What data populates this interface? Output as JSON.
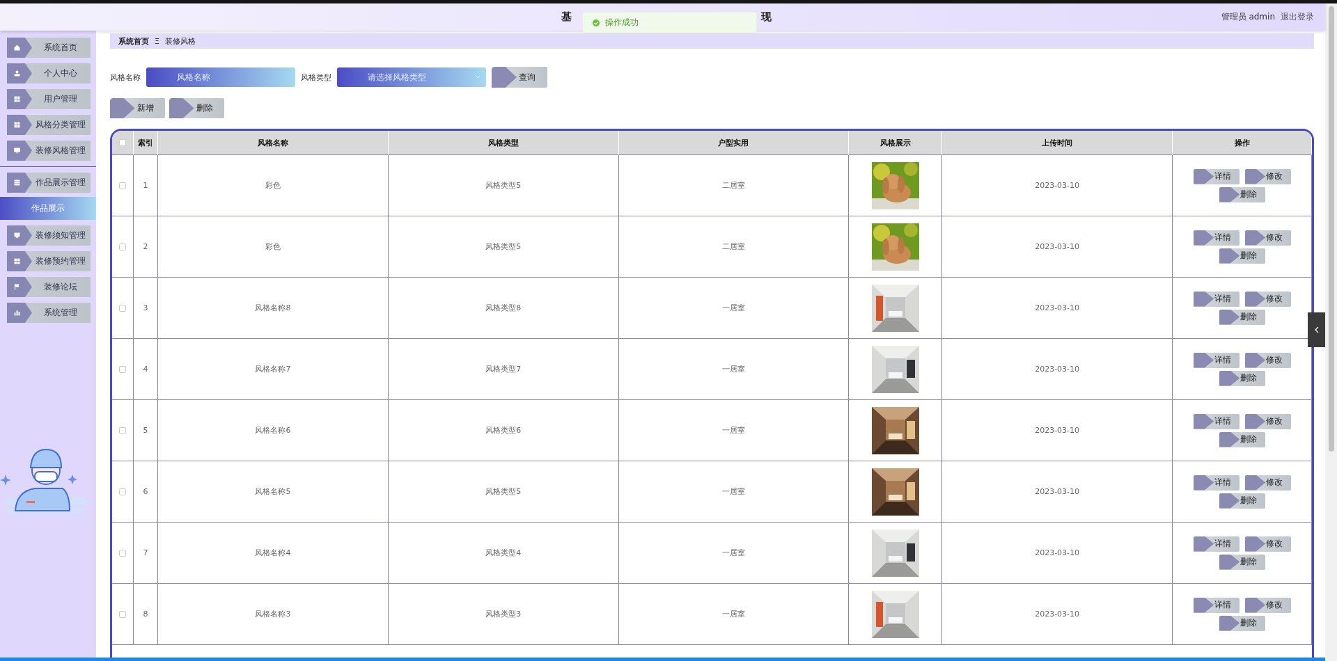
{
  "header": {
    "title_start": "基",
    "title_end": "现",
    "user": "管理员 admin",
    "logout": "退出登录"
  },
  "toast": {
    "message": "操作成功"
  },
  "sidebar": {
    "items": [
      {
        "label": "系统首页"
      },
      {
        "label": "个人中心"
      },
      {
        "label": "用户管理"
      },
      {
        "label": "风格分类管理"
      },
      {
        "label": "装修风格管理"
      },
      {
        "label": "作品展示管理",
        "children": [
          {
            "label": "作品展示",
            "selected": true
          }
        ]
      },
      {
        "label": "装修须知管理"
      },
      {
        "label": "装修预约管理"
      },
      {
        "label": "装修论坛"
      },
      {
        "label": "系统管理"
      }
    ]
  },
  "breadcrumb": {
    "items": [
      "系统首页",
      "装修风格"
    ],
    "separator": "Ξ"
  },
  "search": {
    "fields": [
      {
        "kind": "text",
        "label": "风格名称",
        "placeholder": "风格名称"
      },
      {
        "kind": "select",
        "label": "风格类型",
        "placeholder": "请选择风格类型"
      }
    ],
    "button": "查询"
  },
  "actions": [
    "新增",
    "删除"
  ],
  "table": {
    "select_all_checked": false,
    "columns": [
      "索引",
      "风格名称",
      "风格类型",
      "户型实用",
      "风格展示",
      "上传时间",
      "操作"
    ],
    "rows": [
      {
        "checked": false,
        "index": "1",
        "name": "彩色",
        "type": "风格类型5",
        "layout": "二居室",
        "time": "2023-03-10",
        "actions": [
          "详情",
          "修改",
          "删除"
        ]
      },
      {
        "checked": false,
        "index": "2",
        "name": "彩色",
        "type": "风格类型5",
        "layout": "二居室",
        "time": "2023-03-10",
        "actions": [
          "详情",
          "修改",
          "删除"
        ]
      },
      {
        "checked": false,
        "index": "3",
        "name": "风格名称8",
        "type": "风格类型8",
        "layout": "一居室",
        "time": "2023-03-10",
        "actions": [
          "详情",
          "修改",
          "删除"
        ]
      },
      {
        "checked": false,
        "index": "4",
        "name": "风格名称7",
        "type": "风格类型7",
        "layout": "一居室",
        "time": "2023-03-10",
        "actions": [
          "详情",
          "修改",
          "删除"
        ]
      },
      {
        "checked": false,
        "index": "5",
        "name": "风格名称6",
        "type": "风格类型6",
        "layout": "一居室",
        "time": "2023-03-10",
        "actions": [
          "详情",
          "修改",
          "删除"
        ]
      },
      {
        "checked": false,
        "index": "6",
        "name": "风格名称5",
        "type": "风格类型5",
        "layout": "一居室",
        "time": "2023-03-10",
        "actions": [
          "详情",
          "修改",
          "删除"
        ]
      },
      {
        "checked": false,
        "index": "7",
        "name": "风格名称4",
        "type": "风格类型4",
        "layout": "一居室",
        "time": "2023-03-10",
        "actions": [
          "详情",
          "修改",
          "删除"
        ]
      },
      {
        "checked": false,
        "index": "8",
        "name": "风格名称3",
        "type": "风格类型3",
        "layout": "一居室",
        "time": "2023-03-10",
        "actions": [
          "详情",
          "修改",
          "删除"
        ]
      }
    ]
  }
}
